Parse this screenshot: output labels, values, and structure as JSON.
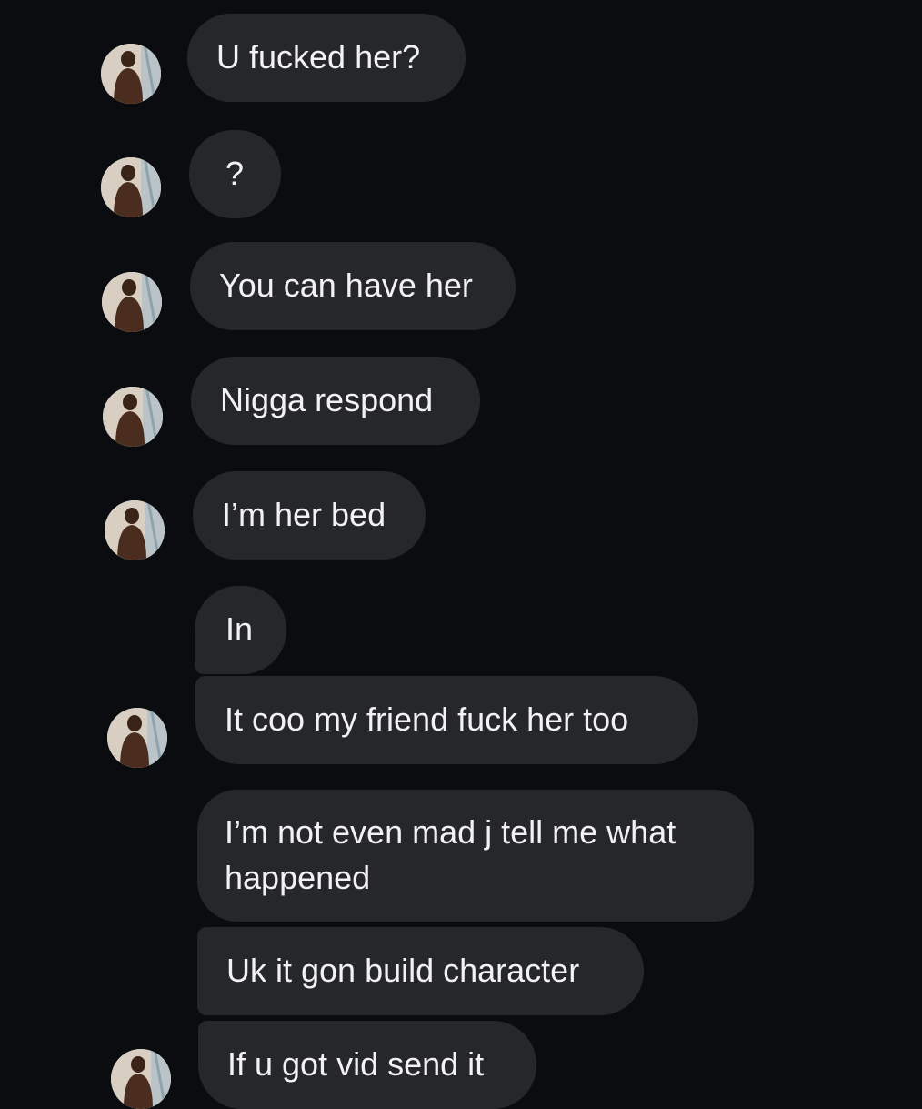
{
  "colors": {
    "background": "#0b0c10",
    "bubble": "#26272b",
    "text": "#f2f2f2"
  },
  "avatar": {
    "icon": "profile-photo"
  },
  "messages": [
    {
      "text": "U fucked her?"
    },
    {
      "text": "?"
    },
    {
      "text": "You can have her"
    },
    {
      "text": "Nigga respond"
    },
    {
      "text": "I’m her bed"
    },
    {
      "text": "In"
    },
    {
      "text": "It coo my friend fuck her too"
    },
    {
      "text": "I’m not even mad j tell me what\nhappened"
    },
    {
      "text": "Uk it gon build character"
    },
    {
      "text": "If u got vid send it"
    }
  ]
}
